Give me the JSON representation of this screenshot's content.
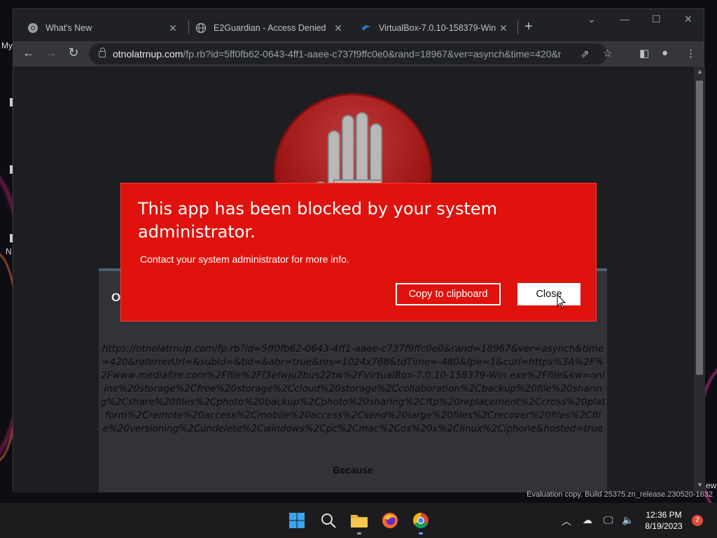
{
  "desktop": {
    "left_labels": [
      "My",
      "N"
    ],
    "right_labels": [
      "ew"
    ]
  },
  "browser": {
    "tabs": [
      {
        "title": "What's New",
        "favicon": "chrome-icon",
        "active": false
      },
      {
        "title": "E2Guardian - Access Denied",
        "favicon": "globe-icon",
        "active": true
      },
      {
        "title": "VirtualBox-7.0.10-158379-Win",
        "favicon": "mediafire-icon",
        "active": false
      }
    ],
    "new_tab": "+",
    "address": {
      "host": "otnolatrnup.com",
      "path": "/fp.rb?id=5ff0fb62-0643-4ff1-aaee-c737f9ffc0e0&rand=18967&ver=asynch&time=420&r..."
    }
  },
  "page": {
    "heading_partial": "O",
    "blocked_url": "https://otnolatrnup.com/fp.rb?id=5ff0fb62-0643-4ff1-aaee-c737f9ffc0e0&rand=18967&ver=asynch&time=420&referrerUrl=&subId=&tid=&abr=true&res=1024x768&tdTime=-480&fpe=1&curl=https%3A%2F%2Fwww.mediafire.com%2Ffile%2Ff3efwju2bus22tw%2FVirtualBox-7.0.10-158379-Win.exe%2Ffile&kw=online%20storage%2Cfree%20storage%2Ccloud%20storage%2Ccollaboration%2Cbackup%20file%20sharing%2Cshare%20files%2Cphoto%20backup%2Cphoto%20sharing%2Cftp%20replacement%2Ccross%20platform%2Cremote%20access%2Cmobile%20access%2Csend%20large%20files%2Crecover%20files%2Cfile%20versioning%2Cundelete%2Cwindows%2Cpc%2Cmac%2Cos%20x%2Clinux%2Ciphone&hosted=true",
    "because": "Because"
  },
  "dialog": {
    "title": "This app has been blocked by your system administrator.",
    "message": "Contact your system administrator for more info.",
    "copy_label": "Copy to clipboard",
    "close_label": "Close",
    "color": "#e0120d"
  },
  "watermark": "Evaluation copy. Build 25375.zn_release.230520-1632",
  "taskbar": {
    "apps": [
      "windows-start-icon",
      "search-icon",
      "file-explorer-icon",
      "firefox-icon",
      "chrome-icon"
    ],
    "time": "12:36 PM",
    "date": "8/19/2023",
    "notifications": "2"
  }
}
